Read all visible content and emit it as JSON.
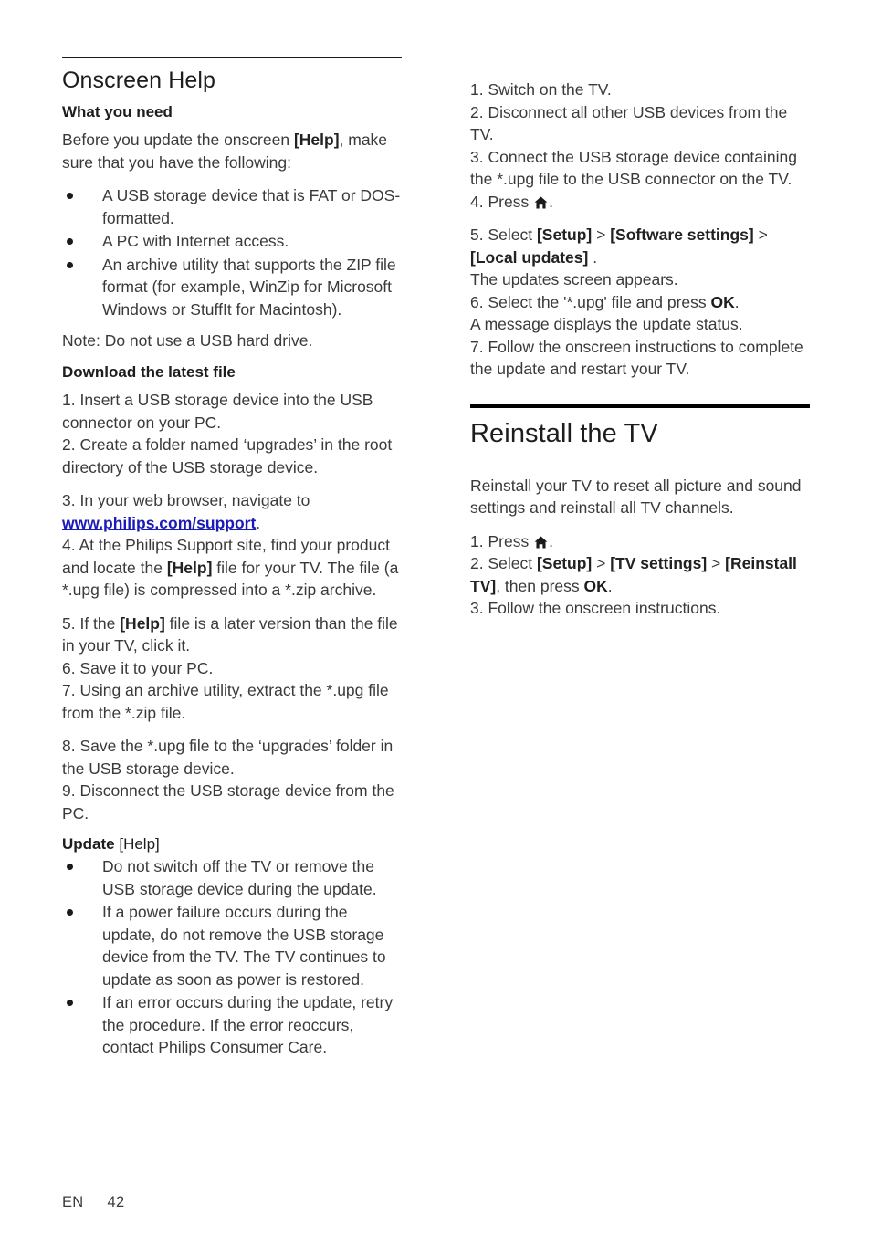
{
  "document": {
    "footer": {
      "language": "EN",
      "page_number": "42"
    }
  },
  "left_column": {
    "section_title": "Onscreen Help",
    "sub1": {
      "title": "What you need"
    },
    "intro": {
      "before": "Before you update the onscreen ",
      "help_bold": "[Help]",
      "after": ", make sure that you have the following:"
    },
    "requirements": [
      "A USB storage device that is FAT or DOS-formatted.",
      "A PC with Internet access.",
      "An archive utility that supports the ZIP file format (for example, WinZip for Microsoft Windows or StuffIt for Macintosh)."
    ],
    "note": "Note: Do not use a USB hard drive.",
    "sub2": {
      "title": "Download the latest file"
    },
    "download_steps_1": "1. Insert a USB storage device into the USB connector on your PC.\n2. Create a folder named ‘upgrades’ in the root directory of the USB storage device.",
    "step3_prefix": "3. In your web browser, navigate to ",
    "step3_link": "www.philips.com/support",
    "step3_suffix": ".",
    "step4_a": "4. At the Philips Support site, find your product and locate the ",
    "step4_help": "[Help]",
    "step4_b": " file for your TV. The file (a *.upg file) is compressed into a *.zip archive.",
    "step5_a": "5. If the ",
    "step5_help": "[Help]",
    "step5_b": " file is a later version than the file in your TV, click it.\n6. Save it to your PC.\n7. Using an archive utility, extract the *.upg file from the *.zip file.",
    "steps_8_9": "8. Save the *.upg file to the ‘upgrades’ folder in the USB storage device.\n9. Disconnect the USB storage device from the PC.",
    "sub3": {
      "title_bold": "Update",
      "title_reg": " [Help]"
    },
    "update_warnings": [
      "Do not switch off the TV or remove the USB storage device during the update.",
      "If a power failure occurs during the update, do not remove the USB storage device from the TV. The TV continues to update as soon as power is restored.",
      "If an error occurs during the update, retry the procedure. If the error reoccurs, contact Philips Consumer Care."
    ]
  },
  "right_column": {
    "update_steps_1_3": "1. Switch on the TV.\n2. Disconnect all other USB devices from the TV.\n3. Connect the USB storage device containing the *.upg file to the USB connector on the TV.",
    "step4_prefix": "4. Press ",
    "step4_icon": "home-icon",
    "step4_suffix": ".",
    "step5_prefix": "5. Select ",
    "step5_setup": "[Setup]",
    "step5_gt1": " > ",
    "step5_software": "[Software settings]",
    "step5_gt2": " > ",
    "step5_local": "[Local updates]",
    "step5_suffix": " .",
    "after_step5": "The updates screen appears.",
    "step6_prefix": "6. Select the '*.upg' file and press ",
    "step6_ok": "OK",
    "step6_suffix": ".",
    "after_step6": "A message displays the update status.",
    "step7": "7. Follow the onscreen instructions to complete the update and restart your TV.",
    "section_title": "Reinstall the TV",
    "reinstall_intro": "Reinstall your TV to reset all picture and sound settings and reinstall all TV channels.",
    "r_step1_prefix": "1. Press ",
    "r_step1_icon": "home-icon",
    "r_step1_suffix": ".",
    "r_step2_prefix": "2. Select ",
    "r_step2_setup": "[Setup]",
    "r_step2_gt1": " > ",
    "r_step2_tvsettings": "[TV settings]",
    "r_step2_gt2": " > ",
    "r_step2_reinstall": "[Reinstall TV]",
    "r_step2_mid": ", then press ",
    "r_step2_ok": "OK",
    "r_step2_suffix": ".",
    "r_step3": "3. Follow the onscreen instructions."
  }
}
